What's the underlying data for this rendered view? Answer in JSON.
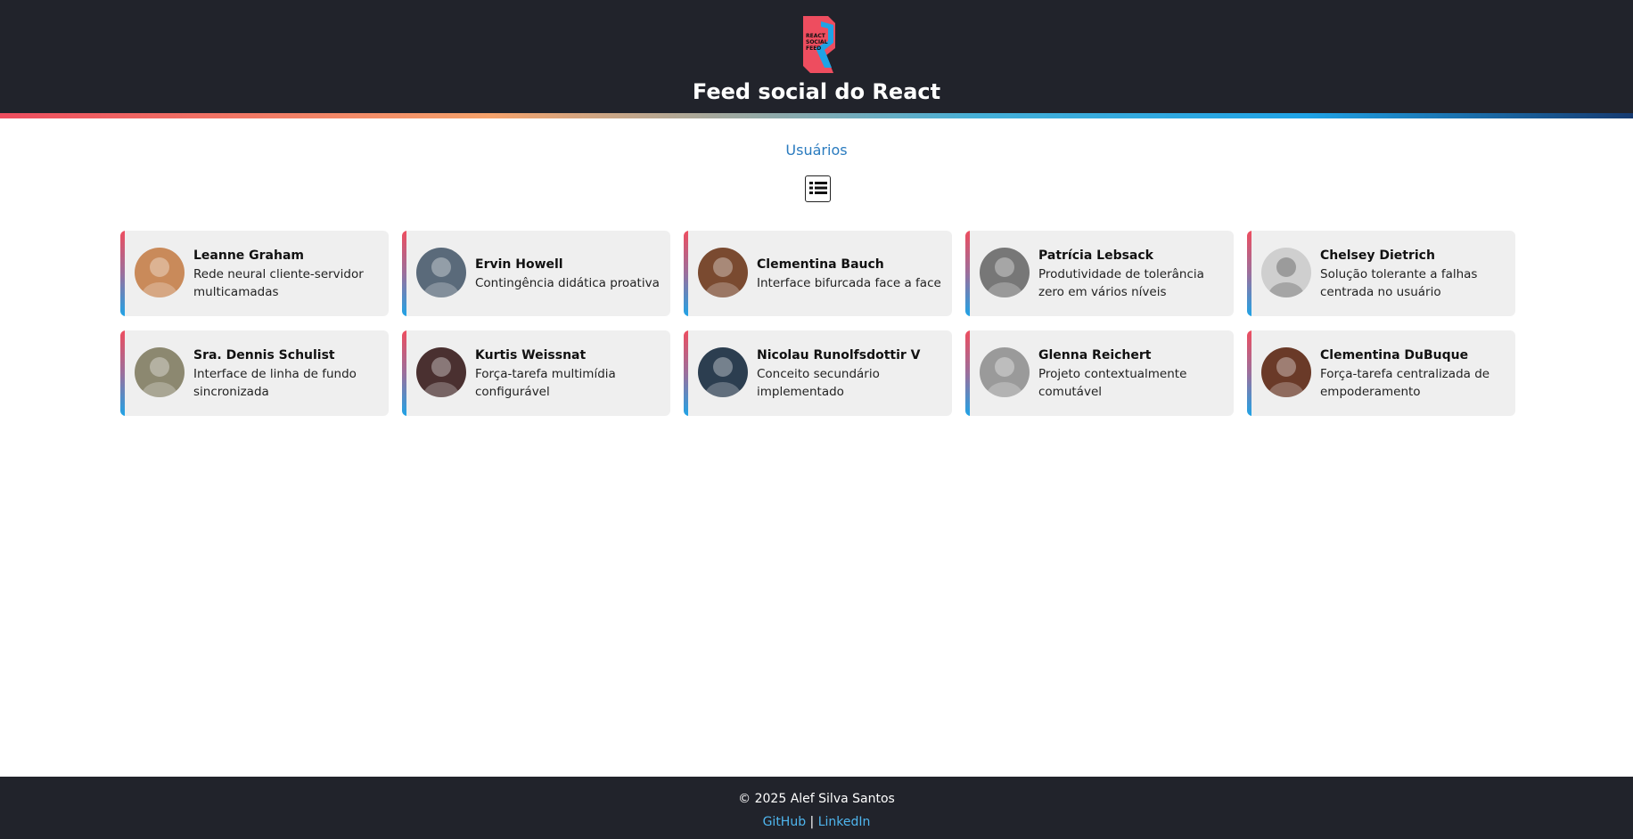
{
  "header": {
    "title": "Feed social do React",
    "logo_lines": [
      "REACT",
      "SOCIAL",
      "FEED"
    ],
    "logo_icon": "react-social-feed-logo"
  },
  "main": {
    "section_title": "Usuários",
    "view_toggle_icon": "list-view-icon"
  },
  "users": [
    {
      "name": "Leanne Graham",
      "description": "Rede neural cliente-servidor multicamadas",
      "avatar_color": "#c98a5a"
    },
    {
      "name": "Ervin Howell",
      "description": "Contingência didática proativa",
      "avatar_color": "#5a6a7a"
    },
    {
      "name": "Clementina Bauch",
      "description": "Interface bifurcada face a face",
      "avatar_color": "#7a4a30"
    },
    {
      "name": "Patrícia Lebsack",
      "description": "Produtividade de tolerância zero em vários níveis",
      "avatar_color": "#777777"
    },
    {
      "name": "Chelsey Dietrich",
      "description": "Solução tolerante a falhas centrada no usuário",
      "avatar_color": "#cfcfcf"
    },
    {
      "name": "Sra. Dennis Schulist",
      "description": "Interface de linha de fundo sincronizada",
      "avatar_color": "#8c8870"
    },
    {
      "name": "Kurtis Weissnat",
      "description": "Força-tarefa multimídia configurável",
      "avatar_color": "#4a3030"
    },
    {
      "name": "Nicolau Runolfsdottir V",
      "description": "Conceito secundário implementado",
      "avatar_color": "#2c3e50"
    },
    {
      "name": "Glenna Reichert",
      "description": "Projeto contextualmente comutável",
      "avatar_color": "#9a9a9a"
    },
    {
      "name": "Clementina DuBuque",
      "description": "Força-tarefa centralizada de empoderamento",
      "avatar_color": "#6a3a28"
    }
  ],
  "footer": {
    "copyright": "© 2025 Alef Silva Santos",
    "links": [
      {
        "label": "GitHub"
      },
      {
        "label": "LinkedIn"
      }
    ],
    "separator": "|"
  },
  "colors": {
    "header_bg": "#21232b",
    "accent_blue": "#2a7bbf",
    "link_blue": "#4fb6ef",
    "card_bg": "#efefef",
    "gradient_red": "#ee4d5f",
    "gradient_blue": "#1fa3e6"
  }
}
